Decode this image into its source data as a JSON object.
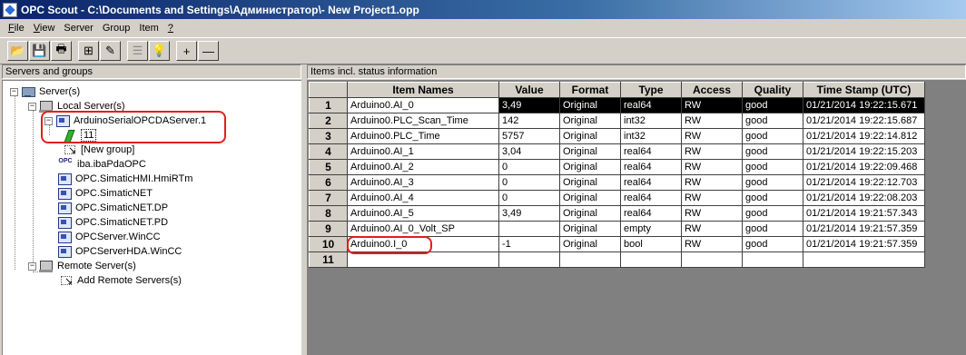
{
  "window": {
    "title": "OPC Scout - C:\\Documents and Settings\\Администратор\\- New Project1.opp",
    "app_icon": "opc-scout-icon"
  },
  "menu": [
    {
      "label": "File",
      "accel": "F",
      "rest": "ile"
    },
    {
      "label": "View",
      "accel": "V",
      "rest": "iew"
    },
    {
      "label": "Server",
      "accel": "",
      "rest": "Server"
    },
    {
      "label": "Group",
      "accel": "",
      "rest": "Group"
    },
    {
      "label": "Item",
      "accel": "",
      "rest": "Item"
    },
    {
      "label": "?",
      "accel": "?",
      "rest": ""
    }
  ],
  "toolbar": {
    "buttons": [
      {
        "name": "open-folder-icon",
        "glyph": "📂",
        "enabled": true
      },
      {
        "name": "save-disk-icon",
        "glyph": "💾",
        "enabled": true
      },
      {
        "name": "print-icon",
        "glyph": "🖶",
        "enabled": true
      },
      {
        "name": "network-icon",
        "glyph": "⊞",
        "enabled": true
      },
      {
        "name": "add-item-icon",
        "glyph": "✎",
        "enabled": true
      },
      {
        "name": "browse-icon",
        "glyph": "☰",
        "enabled": false
      },
      {
        "name": "lightbulb-icon",
        "glyph": "💡",
        "enabled": true
      },
      {
        "name": "plus-icon",
        "glyph": "+",
        "enabled": true
      },
      {
        "name": "minus-icon",
        "glyph": "—",
        "enabled": true
      }
    ]
  },
  "left_pane": {
    "title": "Servers and groups",
    "tree": {
      "root": "Server(s)",
      "local": "Local Server(s)",
      "connected_server": "ArduinoSerialOPCDAServer.1",
      "group": "11",
      "new_group": "[New group]",
      "servers": [
        "iba.ibaPdaOPC",
        "OPC.SimaticHMI.HmiRTm",
        "OPC.SimaticNET",
        "OPC.SimaticNET.DP",
        "OPC.SimaticNET.PD",
        "OPCServer.WinCC",
        "OPCServerHDA.WinCC"
      ],
      "remote": "Remote Server(s)",
      "add_remote": "Add Remote Servers(s)"
    }
  },
  "right_pane": {
    "title": "Items incl. status information",
    "columns": [
      "Item Names",
      "Value",
      "Format",
      "Type",
      "Access",
      "Quality",
      "Time Stamp (UTC)"
    ],
    "rows": [
      {
        "n": "1",
        "name": "Arduino0.AI_0",
        "value": "3,49",
        "format": "Original",
        "type": "real64",
        "access": "RW",
        "quality": "good",
        "time": "01/21/2014 19:22:15.671"
      },
      {
        "n": "2",
        "name": "Arduino0.PLC_Scan_Time",
        "value": "142",
        "format": "Original",
        "type": "int32",
        "access": "RW",
        "quality": "good",
        "time": "01/21/2014 19:22:15.687"
      },
      {
        "n": "3",
        "name": "Arduino0.PLC_Time",
        "value": "5757",
        "format": "Original",
        "type": "int32",
        "access": "RW",
        "quality": "good",
        "time": "01/21/2014 19:22:14.812"
      },
      {
        "n": "4",
        "name": "Arduino0.AI_1",
        "value": "3,04",
        "format": "Original",
        "type": "real64",
        "access": "RW",
        "quality": "good",
        "time": "01/21/2014 19:22:15.203"
      },
      {
        "n": "5",
        "name": "Arduino0.AI_2",
        "value": "0",
        "format": "Original",
        "type": "real64",
        "access": "RW",
        "quality": "good",
        "time": "01/21/2014 19:22:09.468"
      },
      {
        "n": "6",
        "name": "Arduino0.AI_3",
        "value": "0",
        "format": "Original",
        "type": "real64",
        "access": "RW",
        "quality": "good",
        "time": "01/21/2014 19:22:12.703"
      },
      {
        "n": "7",
        "name": "Arduino0.AI_4",
        "value": "0",
        "format": "Original",
        "type": "real64",
        "access": "RW",
        "quality": "good",
        "time": "01/21/2014 19:22:08.203"
      },
      {
        "n": "8",
        "name": "Arduino0.AI_5",
        "value": "3,49",
        "format": "Original",
        "type": "real64",
        "access": "RW",
        "quality": "good",
        "time": "01/21/2014 19:21:57.343"
      },
      {
        "n": "9",
        "name": "Arduino0.AI_0_Volt_SP",
        "value": "",
        "format": "Original",
        "type": "empty",
        "access": "RW",
        "quality": "good",
        "time": "01/21/2014 19:21:57.359"
      },
      {
        "n": "10",
        "name": "Arduino0.I_0",
        "value": "-1",
        "format": "Original",
        "type": "bool",
        "access": "RW",
        "quality": "good",
        "time": "01/21/2014 19:21:57.359"
      },
      {
        "n": "11",
        "name": "",
        "value": "",
        "format": "",
        "type": "",
        "access": "",
        "quality": "",
        "time": ""
      }
    ]
  }
}
